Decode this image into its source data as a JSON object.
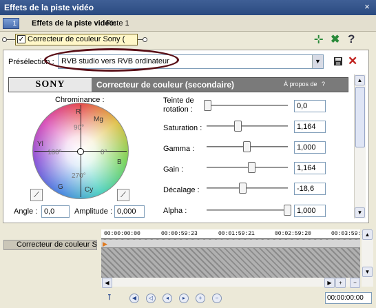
{
  "window": {
    "title": "Effets de la piste vidéo",
    "close_label": "×"
  },
  "header": {
    "track_number": "1",
    "label": "Effets de la piste vidéo:",
    "track": "Piste 1"
  },
  "chain": {
    "plugin_label": "Correcteur de couleur Sony ("
  },
  "toolbar": {
    "plugin_icon": "plug-icon",
    "remove_icon": "remove-plug-icon",
    "help_label": "?"
  },
  "preset": {
    "label": "Présélection :",
    "value": "RVB studio vers RVB ordinateur"
  },
  "banner": {
    "brand": "SONY",
    "effect_name": "Correcteur de couleur (secondaire)",
    "about": "À propos de",
    "about_q": "?"
  },
  "chroma": {
    "label": "Chrominance :",
    "labels": {
      "r": "R",
      "mg": "Mg",
      "yl": "Yl",
      "b": "B",
      "g": "G",
      "cy": "Cy",
      "d90": "90°",
      "d180": "180°",
      "d0": "0°",
      "d270": "270°"
    }
  },
  "angle": {
    "label": "Angle :",
    "value": "0,0"
  },
  "amplitude": {
    "label": "Amplitude :",
    "value": "0,000"
  },
  "params": [
    {
      "label": "Teinte de rotation :",
      "label1": "Teinte de",
      "label2": "rotation :",
      "value": "0,0",
      "level": 0.0
    },
    {
      "label": "Saturation :",
      "value": "1,164",
      "level": 0.38
    },
    {
      "label": "Gamma :",
      "value": "1,000",
      "level": 0.49
    },
    {
      "label": "Gain :",
      "value": "1,164",
      "level": 0.55
    },
    {
      "label": "Décalage :",
      "value": "-18,6",
      "level": 0.44
    },
    {
      "label": "Alpha :",
      "value": "1,000",
      "level": 1.0
    }
  ],
  "timeline": {
    "track_label": "Correcteur de couleur So",
    "ticks": [
      "00:00:00:00",
      "00:00:59:23",
      "00:01:59:21",
      "00:02:59:20",
      "00:03:59:1"
    ],
    "timecode": "00:00:00:00"
  },
  "colors": {
    "title": "#2f5090",
    "banner": "#7a7a7a",
    "ellipse": "#5a1018"
  }
}
